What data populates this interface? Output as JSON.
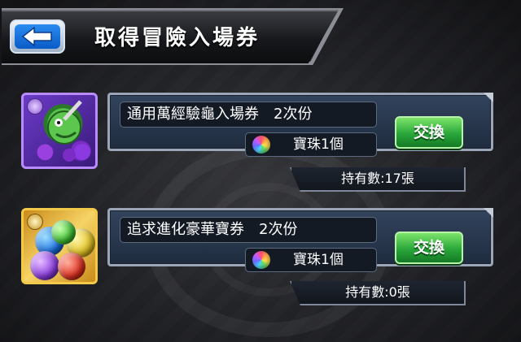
{
  "header": {
    "title": "取得冒險入場券"
  },
  "items": [
    {
      "name": "通用萬經驗龜入場券　2次份",
      "cost": "寶珠1個",
      "exchange_label": "交換",
      "owned": "持有數:17張"
    },
    {
      "name": "追求進化豪華寶券　2次份",
      "cost": "寶珠1個",
      "exchange_label": "交換",
      "owned": "持有數:0張"
    }
  ]
}
